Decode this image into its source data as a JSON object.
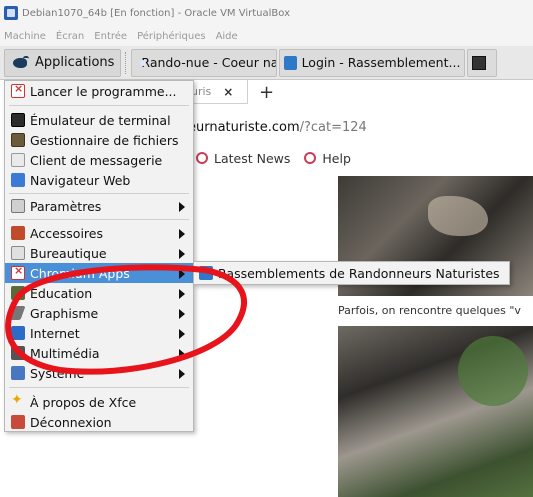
{
  "window": {
    "title": "Debian1070_64b [En fonction] - Oracle VM VirtualBox",
    "menu": [
      "Machine",
      "Écran",
      "Entrée",
      "Périphériques",
      "Aide"
    ]
  },
  "panel": {
    "applications_label": "Applications",
    "tasks": [
      {
        "label": "Rando-nue - Coeur natu..."
      },
      {
        "label": "Login - Rassemblement..."
      }
    ]
  },
  "browser": {
    "tab_fragment": "uris",
    "url_host": "eurnaturiste.com",
    "url_path": "/?cat=124",
    "bookmarks": [
      "Latest News",
      "Help"
    ],
    "caption": "Parfois, on rencontre quelques \"v"
  },
  "menu": {
    "items": [
      {
        "label": "Lancer le programme..."
      },
      {
        "label": "Émulateur de terminal"
      },
      {
        "label": "Gestionnaire de fichiers"
      },
      {
        "label": "Client de messagerie"
      },
      {
        "label": "Navigateur Web"
      },
      {
        "label": "Paramètres"
      },
      {
        "label": "Accessoires"
      },
      {
        "label": "Bureautique"
      },
      {
        "label": "Chromium Apps"
      },
      {
        "label": "Éducation"
      },
      {
        "label": "Graphisme"
      },
      {
        "label": "Internet"
      },
      {
        "label": "Multimédia"
      },
      {
        "label": "Système"
      },
      {
        "label": "À propos de Xfce"
      },
      {
        "label": "Déconnexion"
      }
    ],
    "selected_label": "Chromium Apps"
  },
  "submenu": {
    "item_label": "Rassemblements de Randonneurs Naturistes"
  },
  "colors": {
    "selection": "#4a90d9",
    "annotation": "#e8141c"
  }
}
